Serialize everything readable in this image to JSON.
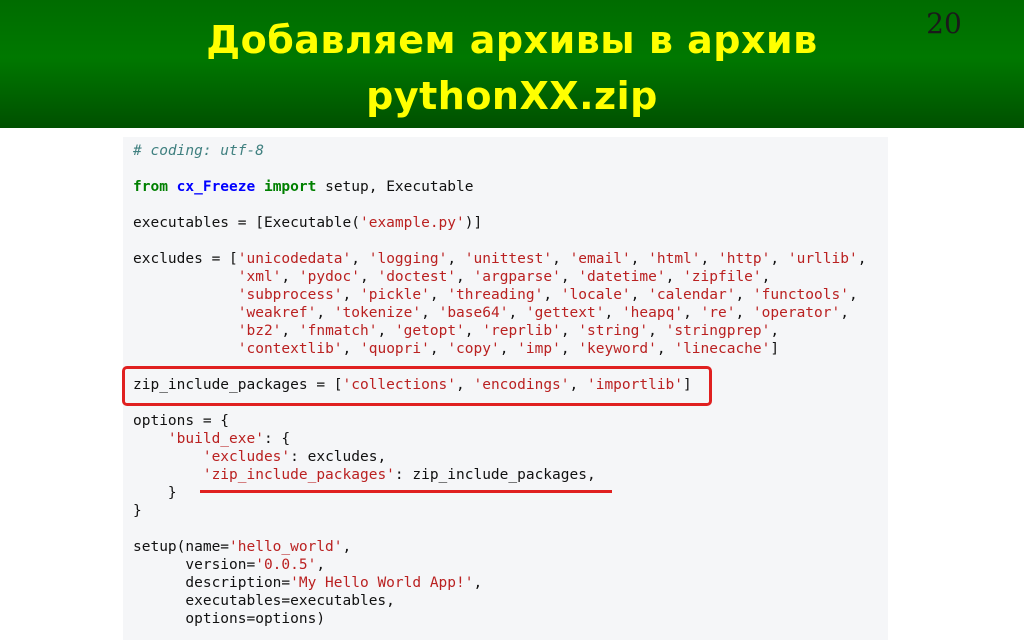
{
  "slide": {
    "title_line1": "Добавляем архивы в архив",
    "title_line2": "pythonXX.zip",
    "page_number": "20"
  },
  "code": {
    "l01": "# coding: utf-8",
    "l03_from": "from",
    "l03_module": "cx_Freeze",
    "l03_import": "import",
    "l03_rest": " setup, Executable",
    "l05_pre": "executables = [Executable(",
    "l05_str": "'example.py'",
    "l05_post": ")]",
    "l07_pre": "excludes = [",
    "l07_s1": "'unicodedata'",
    "l07_s2": "'logging'",
    "l07_s3": "'unittest'",
    "l07_s4": "'email'",
    "l07_s5": "'html'",
    "l07_s6": "'http'",
    "l07_s7": "'urllib'",
    "l08_s1": "'xml'",
    "l08_s2": "'pydoc'",
    "l08_s3": "'doctest'",
    "l08_s4": "'argparse'",
    "l08_s5": "'datetime'",
    "l08_s6": "'zipfile'",
    "l09_s1": "'subprocess'",
    "l09_s2": "'pickle'",
    "l09_s3": "'threading'",
    "l09_s4": "'locale'",
    "l09_s5": "'calendar'",
    "l09_s6": "'functools'",
    "l10_s1": "'weakref'",
    "l10_s2": "'tokenize'",
    "l10_s3": "'base64'",
    "l10_s4": "'gettext'",
    "l10_s5": "'heapq'",
    "l10_s6": "'re'",
    "l10_s7": "'operator'",
    "l11_s1": "'bz2'",
    "l11_s2": "'fnmatch'",
    "l11_s3": "'getopt'",
    "l11_s4": "'reprlib'",
    "l11_s5": "'string'",
    "l11_s6": "'stringprep'",
    "l12_s1": "'contextlib'",
    "l12_s2": "'quopri'",
    "l12_s3": "'copy'",
    "l12_s4": "'imp'",
    "l12_s5": "'keyword'",
    "l12_s6": "'linecache'",
    "l14_pre": "zip_include_packages = [",
    "l14_s1": "'collections'",
    "l14_s2": "'encodings'",
    "l14_s3": "'importlib'",
    "l16": "options = {",
    "l17_str": "'build_exe'",
    "l17_post": ": {",
    "l18_str": "'excludes'",
    "l18_post": ": excludes,",
    "l19_str": "'zip_include_packages'",
    "l19_post": ": zip_include_packages,",
    "l20": "    }",
    "l21": "}",
    "l23_pre": "setup(name=",
    "l23_str": "'hello_world'",
    "l24_pre": "      version=",
    "l24_str": "'0.0.5'",
    "l25_pre": "      description=",
    "l25_str": "'My Hello World App!'",
    "l26": "      executables=executables,",
    "l27": "      options=options)"
  },
  "colors": {
    "header_green": "#007800",
    "title_yellow": "#ffff00",
    "highlight_red": "#e02020",
    "keyword_green": "#008000",
    "module_blue": "#0000ff",
    "string_red": "#ba2121",
    "comment_teal": "#408080"
  }
}
